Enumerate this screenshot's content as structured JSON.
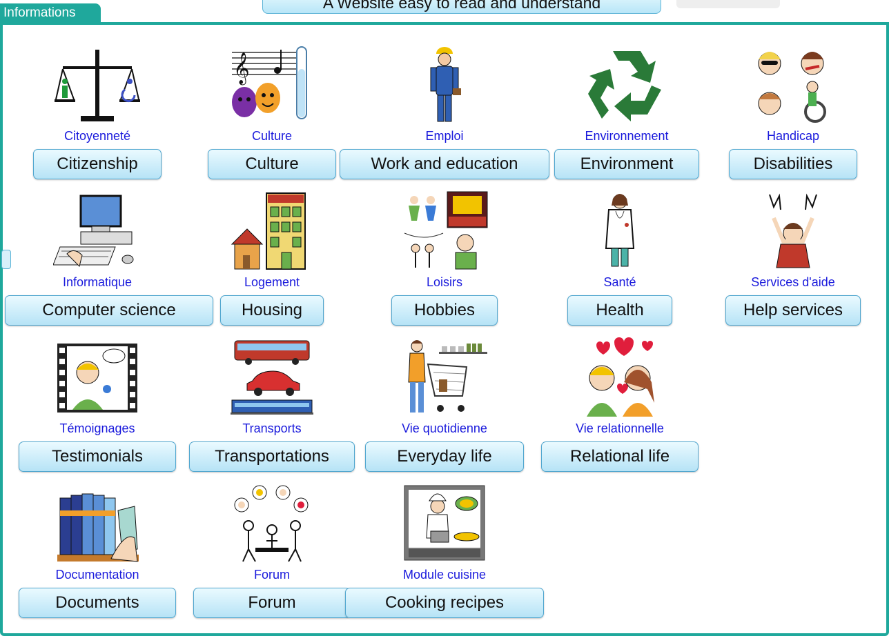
{
  "header": {
    "tab_label": "Informations",
    "banner_text": "A Website easy to read and understand"
  },
  "tiles": [
    {
      "icon": "scales-icon",
      "french": "Citoyenneté",
      "english": "Citizenship"
    },
    {
      "icon": "music-theater-icon",
      "french": "Culture",
      "english": "Culture"
    },
    {
      "icon": "worker-icon",
      "french": "Emploi",
      "english": "Work and education"
    },
    {
      "icon": "recycle-icon",
      "french": "Environnement",
      "english": "Environment"
    },
    {
      "icon": "disability-icon",
      "french": "Handicap",
      "english": "Disabilities"
    },
    {
      "icon": "computer-icon",
      "french": "Informatique",
      "english": "Computer science"
    },
    {
      "icon": "housing-icon",
      "french": "Logement",
      "english": "Housing"
    },
    {
      "icon": "hobbies-icon",
      "french": "Loisirs",
      "english": "Hobbies"
    },
    {
      "icon": "doctor-icon",
      "french": "Santé",
      "english": "Health"
    },
    {
      "icon": "help-icon",
      "french": "Services d'aide",
      "english": "Help services"
    },
    {
      "icon": "testimony-icon",
      "french": "Témoignages",
      "english": "Testimonials"
    },
    {
      "icon": "transport-icon",
      "french": "Transports",
      "english": "Transportations"
    },
    {
      "icon": "shopping-cart-icon",
      "french": "Vie quotidienne",
      "english": "Everyday life"
    },
    {
      "icon": "couple-icon",
      "french": "Vie relationnelle",
      "english": "Relational life"
    },
    {
      "icon": "books-icon",
      "french": "Documentation",
      "english": "Documents"
    },
    {
      "icon": "forum-icon",
      "french": "Forum",
      "english": "Forum"
    },
    {
      "icon": "cooking-icon",
      "french": "Module cuisine",
      "english": "Cooking recipes"
    }
  ],
  "colors": {
    "accent": "#1fa89c",
    "french_label": "#1a1adc",
    "button_border": "#4fa6cf"
  }
}
